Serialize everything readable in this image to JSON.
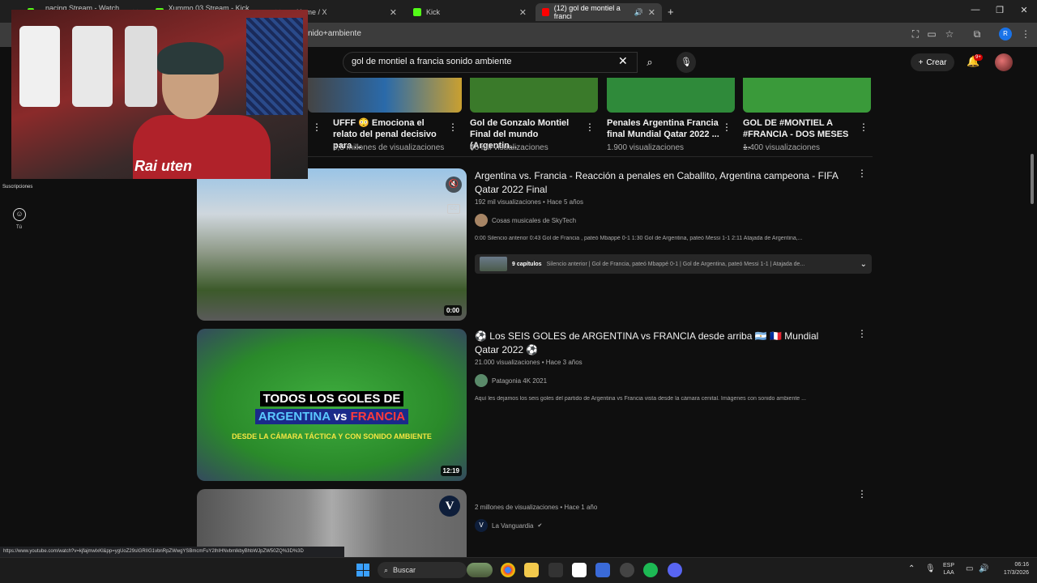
{
  "browser": {
    "tabs": [
      {
        "label": "...nacing Stream - Watch Live ...",
        "color": "#53fc18"
      },
      {
        "label": "Xummo 03 Stream - Kick Derb...",
        "color": "#53fc18"
      },
      {
        "label": "Home / X",
        "color": "#ffffff"
      },
      {
        "label": "Kick",
        "color": "#53fc18"
      },
      {
        "label": "(12) gol de montiel a franci",
        "color": "#ff0000"
      }
    ],
    "new_tab_label": "+",
    "url_visible": "nido+ambiente",
    "profile_initial": "R"
  },
  "youtube": {
    "search": {
      "value": "gol de montiel a francia sonido ambiente"
    },
    "create_label": "Crear",
    "notifications_badge": "9+",
    "sidebar": {
      "subscriptions_label": "Suscripciones",
      "you_label": "Tú"
    }
  },
  "webcam": {
    "shirt_text": "Rai uten"
  },
  "shorts": [
    {
      "title": "UFFF 😳 Emociona el relato del penal decisivo para ...",
      "views": "6,5 millones de visualizaciones",
      "color": "#3a4a5a"
    },
    {
      "title": "Gol de Gonzalo Montiel Final del mundo (Argentin...",
      "views": "46 mil visualizaciones",
      "color": "#3a7a2a"
    },
    {
      "title": "Penales Argentina Francia final Mundial Qatar 2022 ...",
      "views": "1.900 visualizaciones",
      "color": "#2f8a3a"
    },
    {
      "title": "GOL DE #MONTIEL A #FRANCIA - DOS MESES ...",
      "views": "1.400 visualizaciones",
      "color": "#3a9a3a"
    }
  ],
  "videos": [
    {
      "title": "Argentina vs. Francia - Reacción a penales en Caballito, Argentina campeona - FIFA Qatar 2022 Final",
      "meta": "192 mil visualizaciones • Hace 5 años",
      "channel": "Cosas musicales de SkyTech",
      "description": "0:00 Silencio anterior 0:43 Gol de Francia , pateó Mbappé 0-1 1:30 Gol de Argentina, pateó Messi 1-1 2:11 Atajada de Argentina,...",
      "duration": "0:00",
      "chapters": {
        "count": "9 capítulos",
        "list": "Silencio anterior | Gol de Francia, pateó Mbappé 0-1 | Gol de Argentina, pateó Messi 1-1 | Atajada de..."
      }
    },
    {
      "title": "⚽ Los SEIS GOLES de ARGENTINA vs FRANCIA desde arriba 🇦🇷 🇫🇷 Mundial Qatar 2022 ⚽",
      "meta": "21.000 visualizaciones • Hace 3 años",
      "channel": "Patagonia 4K 2021",
      "description": "Aquí les dejamos los seis goles del partido de Argentina vs Francia vista desde la cámara cenital. Imágenes con sonido ambiente ...",
      "duration": "12:19",
      "thumb_line1": "TODOS LOS GOLES DE",
      "thumb_line2a": "ARGENTINA",
      "thumb_line2b": "vs",
      "thumb_line2c": "FRANCIA",
      "thumb_line3": "DESDE LA CÁMARA TÁCTICA Y CON SONIDO AMBIENTE"
    },
    {
      "title": "",
      "meta": "2 millones de visualizaciones • Hace 1 año",
      "channel": "La Vanguardia",
      "channel_badge": "V",
      "verified": "✔"
    }
  ],
  "status_bar_url": "https://www.youtube.com/watch?v=kjfajmwlxKl&pp=ygUoZ29sIGRIIG1vbnRpZWwgYSBmcmFuY2lhIHNvbmlkbyBhbWJpZW50ZQ%3D%3D",
  "taskbar": {
    "search_label": "Buscar",
    "lang_line1": "ESP",
    "lang_line2": "LAA",
    "time": "06:16",
    "date": "17/3/2026"
  }
}
